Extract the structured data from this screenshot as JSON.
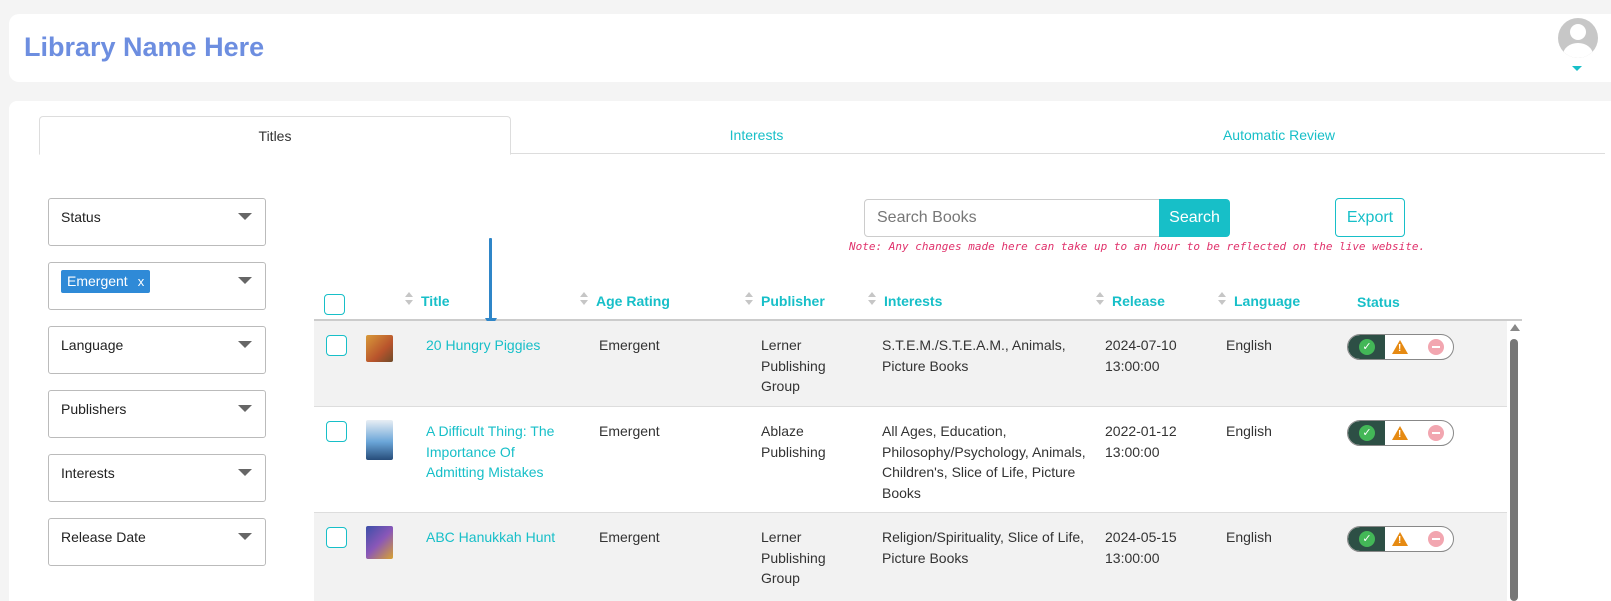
{
  "header": {
    "library_name": "Library Name Here"
  },
  "tabs": [
    {
      "label": "Titles",
      "active": true
    },
    {
      "label": "Interests",
      "active": false
    },
    {
      "label": "Automatic Review",
      "active": false
    }
  ],
  "filters": {
    "status": "Status",
    "age_rating_chip": "Emergent",
    "age_rating_chip_remove": "x",
    "language": "Language",
    "publishers": "Publishers",
    "interests": "Interests",
    "release_date": "Release Date"
  },
  "search": {
    "placeholder": "Search Books",
    "button": "Search"
  },
  "export_label": "Export",
  "note": "Note: Any changes made here can take up to an hour to be reflected on the live website.",
  "table": {
    "columns": [
      "Title",
      "Age Rating",
      "Publisher",
      "Interests",
      "Release",
      "Language",
      "Status"
    ],
    "rows": [
      {
        "title": "20 Hungry Piggies",
        "age_rating": "Emergent",
        "publisher": "Lerner Publishing Group",
        "interests": "S.T.E.M./S.T.E.A.M., Animals, Picture Books",
        "release": "2024-07-10 13:00:00",
        "language": "English"
      },
      {
        "title": "A Difficult Thing: The Importance Of Admitting Mistakes",
        "age_rating": "Emergent",
        "publisher": "Ablaze Publishing",
        "interests": "All Ages, Education, Philosophy/Psychology, Animals, Children's, Slice of Life, Picture Books",
        "release": "2022-01-12 13:00:00",
        "language": "English"
      },
      {
        "title": "ABC Hanukkah Hunt",
        "age_rating": "Emergent",
        "publisher": "Lerner Publishing Group",
        "interests": "Religion/Spirituality, Slice of Life, Picture Books",
        "release": "2024-05-15 13:00:00",
        "language": "English"
      }
    ]
  },
  "colors": {
    "accent": "#17bfc8",
    "brand": "#6d8ee0",
    "chip": "#2f8ad7",
    "note": "#e0316b"
  }
}
